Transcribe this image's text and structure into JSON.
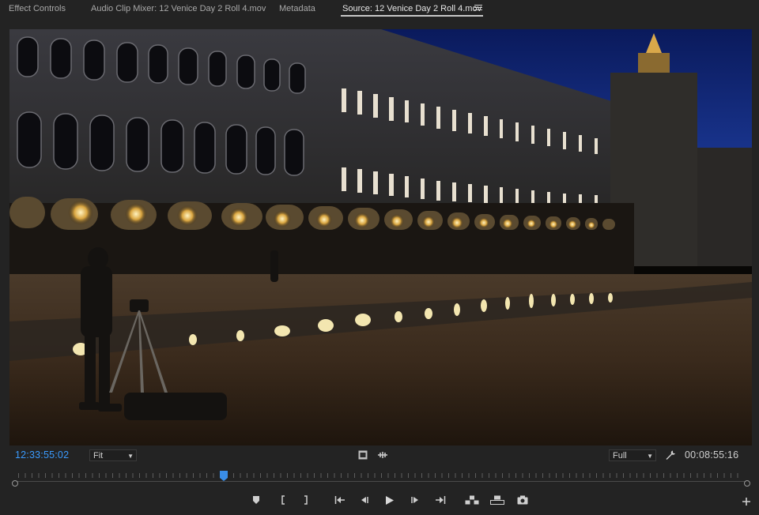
{
  "tabs": [
    {
      "label": "Effect Controls",
      "active": false
    },
    {
      "label": "Audio Clip Mixer: 12 Venice Day 2 Roll 4.mov",
      "active": false
    },
    {
      "label": "Metadata",
      "active": false
    },
    {
      "label": "Source: 12 Venice Day 2 Roll 4.mov",
      "active": true
    }
  ],
  "viewer": {
    "playhead_timecode": "12:33:55:02",
    "duration_timecode": "00:08:55:16",
    "zoom": "Fit",
    "resolution": "Full",
    "playhead_position": 0.285
  },
  "colors": {
    "accent": "#3a9bff",
    "panel_bg": "#232323",
    "text": "#c9c9c9"
  },
  "icons": {
    "panel_menu": "hamburger-menu-icon",
    "drag_video": "filmstrip-icon",
    "drag_audio": "audio-waveform-icon",
    "settings": "wrench-icon",
    "add_marker": "marker-icon",
    "mark_in": "mark-in-icon",
    "mark_out": "mark-out-icon",
    "go_to_in": "go-to-in-icon",
    "step_back": "step-back-icon",
    "play": "play-icon",
    "step_forward": "step-forward-icon",
    "go_to_out": "go-to-out-icon",
    "insert": "insert-icon",
    "overwrite": "overwrite-icon",
    "export_frame": "camera-icon",
    "button_editor": "plus-icon"
  }
}
